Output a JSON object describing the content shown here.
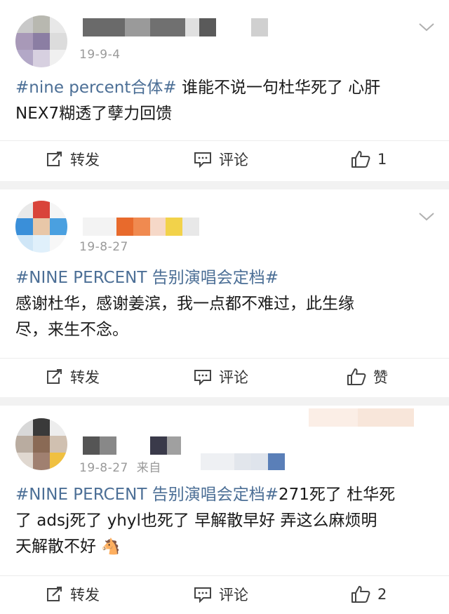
{
  "posts": [
    {
      "date": "19-9-4",
      "topic": "#nine percent合体#",
      "text_line1": " 谁能不说一句杜华死了 心肝",
      "text_line2": "NEX7糊透了孽力回馈",
      "repost_label": "转发",
      "comment_label": "评论",
      "like_label": "1"
    },
    {
      "date": "19-8-27",
      "topic": "#NINE PERCENT 告别演唱会定档#",
      "text_line1": "感谢杜华，感谢姜滨，我一点都不难过，此生缘",
      "text_line2": "尽，来生不念。",
      "repost_label": "转发",
      "comment_label": "评论",
      "like_label": "赞"
    },
    {
      "date": "19-8-27",
      "source_prefix": "来自",
      "topic": "#NINE PERCENT 告别演唱会定档#",
      "text_line1_rest": "271死了 杜华死",
      "text_line2": "了 adsj死了 yhyl也死了 早解散早好 弄这么麻烦明",
      "text_line3": "天解散不好",
      "emoji": "🐴",
      "repost_label": "转发",
      "comment_label": "评论",
      "like_label": "2"
    }
  ],
  "colors": {
    "topic": "#4c6f96",
    "date": "#9a9a9a",
    "separator": "#f2f2f2"
  },
  "icons": [
    "repost-icon",
    "comment-icon",
    "like-icon",
    "chevron-down-icon"
  ]
}
